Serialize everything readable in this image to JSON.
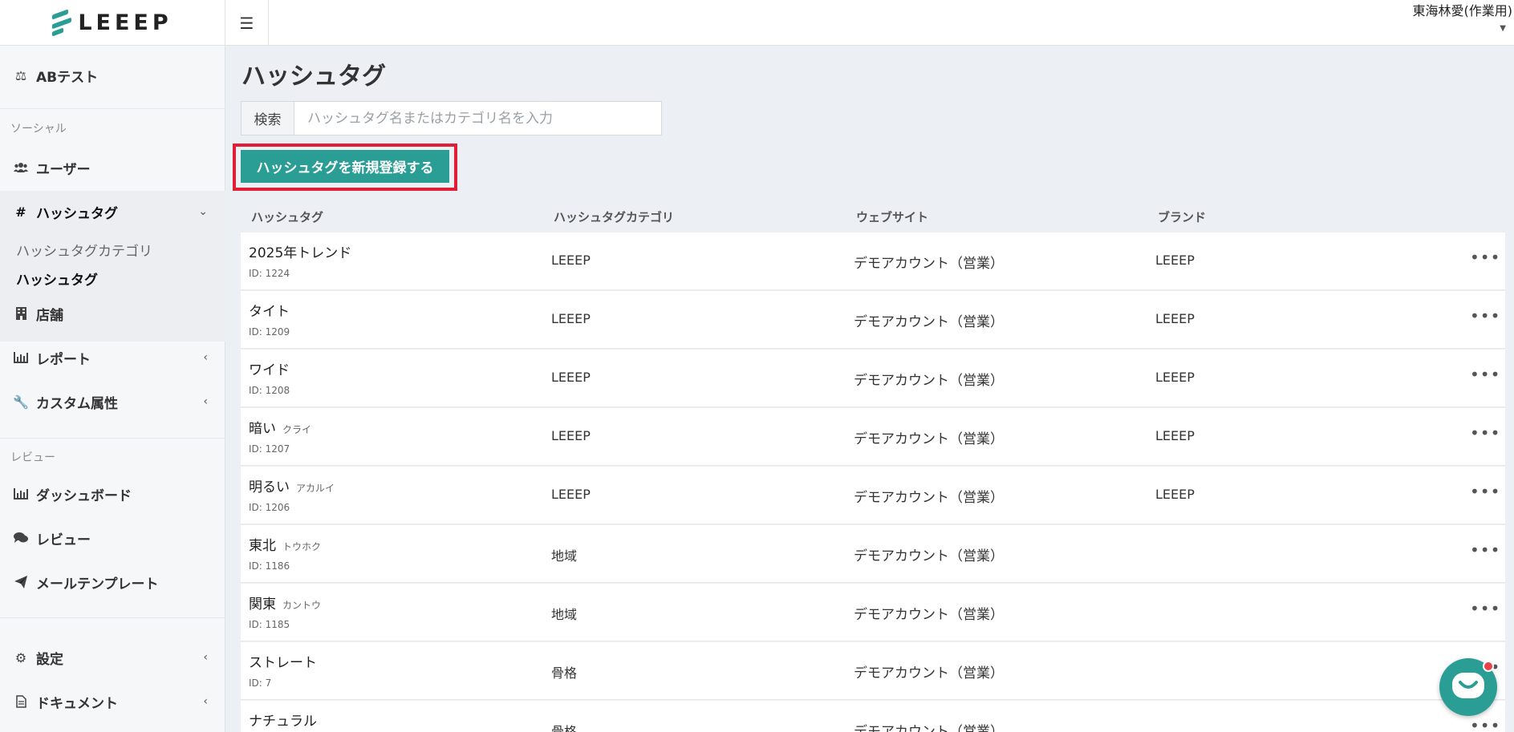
{
  "header": {
    "logo_text": "LEEEP",
    "menu_icon": "hamburger-icon",
    "user_name": "東海林愛(作業用)"
  },
  "sidebar": {
    "ab_test": "ABテスト",
    "section_social": "ソーシャル",
    "users": "ユーザー",
    "hashtags": "ハッシュタグ",
    "sub_hashtag_category": "ハッシュタグカテゴリ",
    "sub_hashtag": "ハッシュタグ",
    "stores": "店舗",
    "reports": "レポート",
    "custom_attributes": "カスタム属性",
    "section_review": "レビュー",
    "dashboard": "ダッシュボード",
    "reviews": "レビュー",
    "mail_template": "メールテンプレート",
    "settings": "設定",
    "documents": "ドキュメント"
  },
  "main": {
    "title": "ハッシュタグ",
    "search_label": "検索",
    "search_placeholder": "ハッシュタグ名またはカテゴリ名を入力",
    "new_button": "ハッシュタグを新規登録する",
    "columns": [
      "ハッシュタグ",
      "ハッシュタグカテゴリ",
      "ウェブサイト",
      "ブランド"
    ],
    "rows": [
      {
        "name": "2025年トレンド",
        "kana": "",
        "id": "ID: 1224",
        "category": "LEEEP",
        "website": "デモアカウント（営業）",
        "brand": "LEEEP"
      },
      {
        "name": "タイト",
        "kana": "",
        "id": "ID: 1209",
        "category": "LEEEP",
        "website": "デモアカウント（営業）",
        "brand": "LEEEP"
      },
      {
        "name": "ワイド",
        "kana": "",
        "id": "ID: 1208",
        "category": "LEEEP",
        "website": "デモアカウント（営業）",
        "brand": "LEEEP"
      },
      {
        "name": "暗い",
        "kana": "クライ",
        "id": "ID: 1207",
        "category": "LEEEP",
        "website": "デモアカウント（営業）",
        "brand": "LEEEP"
      },
      {
        "name": "明るい",
        "kana": "アカルイ",
        "id": "ID: 1206",
        "category": "LEEEP",
        "website": "デモアカウント（営業）",
        "brand": "LEEEP"
      },
      {
        "name": "東北",
        "kana": "トウホク",
        "id": "ID: 1186",
        "category": "地域",
        "website": "デモアカウント（営業）",
        "brand": ""
      },
      {
        "name": "関東",
        "kana": "カントウ",
        "id": "ID: 1185",
        "category": "地域",
        "website": "デモアカウント（営業）",
        "brand": ""
      },
      {
        "name": "ストレート",
        "kana": "",
        "id": "ID: 7",
        "category": "骨格",
        "website": "デモアカウント（営業）",
        "brand": ""
      },
      {
        "name": "ナチュラル",
        "kana": "",
        "id": "",
        "category": "骨格",
        "website": "デモアカウント（営業）",
        "brand": ""
      }
    ],
    "row_menu_label": "•••"
  },
  "colors": {
    "accent": "#2a9d95",
    "highlight": "#e01e37",
    "notification": "#e8414a"
  }
}
